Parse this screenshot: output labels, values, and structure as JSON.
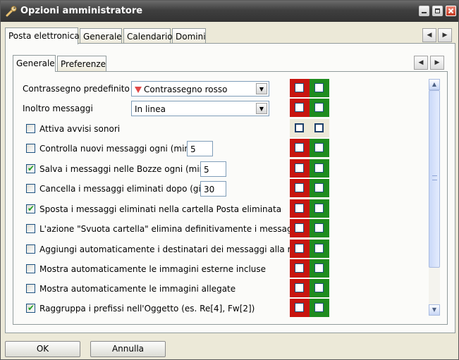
{
  "window": {
    "title": "Opzioni amministratore"
  },
  "outer_tabs": [
    "Posta elettronica",
    "Generale",
    "Calendario",
    "Domini"
  ],
  "inner_tabs": [
    "Generale",
    "Preferenze"
  ],
  "settings": [
    {
      "label": "Contrassegno predefinito",
      "type": "combo",
      "value": "Contrassegno rosso",
      "icon": "red-flag-icon"
    },
    {
      "label": "Inoltro messaggi",
      "type": "combo",
      "value": "In linea"
    },
    {
      "label": "Attiva avvisi sonori",
      "type": "checkbox",
      "checked": false
    },
    {
      "label": "Controlla nuovi messaggi ogni (minuti)",
      "type": "checkbox-number",
      "checked": false,
      "value": "5"
    },
    {
      "label": "Salva i messaggi nelle Bozze ogni (minuti)",
      "type": "checkbox-number",
      "checked": true,
      "value": "5"
    },
    {
      "label": "Cancella i messaggi eliminati dopo (giorni)",
      "type": "checkbox-number",
      "checked": false,
      "value": "30"
    },
    {
      "label": "Sposta i messaggi eliminati nella cartella Posta eliminata",
      "type": "checkbox",
      "checked": true
    },
    {
      "label": "L'azione \"Svuota cartella\" elimina definitivamente i messaggi",
      "type": "checkbox",
      "checked": false
    },
    {
      "label": "Aggiungi automaticamente i destinatari dei messaggi alla rubrica",
      "type": "checkbox",
      "checked": false
    },
    {
      "label": "Mostra automaticamente le immagini esterne incluse",
      "type": "checkbox",
      "checked": false
    },
    {
      "label": "Mostra automaticamente le immagini allegate",
      "type": "checkbox",
      "checked": false
    },
    {
      "label": "Raggruppa i prefissi nell'Oggetto (es. Re[4], Fw[2])",
      "type": "checkbox",
      "checked": true
    }
  ],
  "buttons": {
    "ok": "OK",
    "cancel": "Annulla"
  },
  "colors": {
    "deny": "#c8150f",
    "allow": "#1f8c1f"
  }
}
